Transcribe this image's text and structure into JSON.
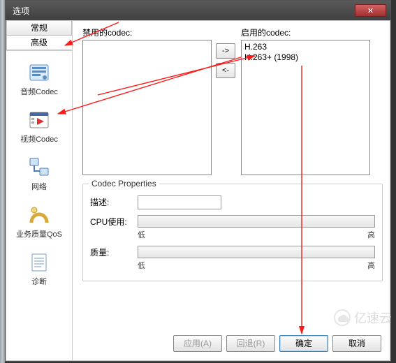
{
  "window": {
    "title": "选项"
  },
  "titlebar": {
    "close_icon": "✕"
  },
  "tabs": {
    "general": "常规",
    "advanced": "高级"
  },
  "sidebar": {
    "items": [
      {
        "label": "音频Codec",
        "icon": "audio-codec-icon"
      },
      {
        "label": "视频Codec",
        "icon": "video-codec-icon"
      },
      {
        "label": "网络",
        "icon": "network-icon"
      },
      {
        "label": "业务质量QoS",
        "icon": "qos-icon"
      },
      {
        "label": "诊断",
        "icon": "diagnostics-icon"
      }
    ]
  },
  "codec": {
    "disabled_label": "禁用的codec:",
    "enabled_label": "启用的codec:",
    "move_right": "->",
    "move_left": "<-",
    "disabled_items": [],
    "enabled_items": [
      "H.263",
      "H.263+ (1998)"
    ]
  },
  "props": {
    "group_title": "Codec Properties",
    "desc_label": "描述:",
    "desc_value": "",
    "cpu_label": "CPU使用:",
    "quality_label": "质量:",
    "low": "低",
    "high": "高"
  },
  "buttons": {
    "apply": "应用(A)",
    "back": "回退(R)",
    "ok": "确定",
    "cancel": "取消"
  },
  "watermark": {
    "text": "亿速云"
  }
}
